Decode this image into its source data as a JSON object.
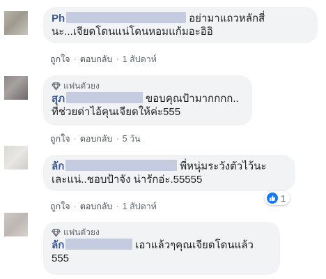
{
  "comments": [
    {
      "badge": "",
      "name": "Ph",
      "text_line1": "อย่ามาแถวหลักสี่",
      "text_line2": "นะ...เจียดโดนแน่โดนหอมแก้มอะอิอิ",
      "like": "ถูกใจ",
      "reply": "ตอบกลับ",
      "time": "1 สัปดาห์"
    },
    {
      "badge": "แฟนตัวยง",
      "name": "สุภ",
      "text_line1": "ขอบคุณป้ามากกกก..",
      "text_line2": "ที่ช่วยด่าไอ้คุนเจียดให้ค่ะ555",
      "like": "ถูกใจ",
      "reply": "ตอบกลับ",
      "time": "5 วัน"
    },
    {
      "badge": "",
      "name": "ลัก",
      "text_line1": "พี่หนุ่มระวังตัวไว้นะ",
      "text_line2": "เละแน่..ชอบป้าจัง น่ารักอ่ะ.55555",
      "like": "ถูกใจ",
      "reply": "ตอบกลับ",
      "time": "1 สัปดาห์",
      "reaction_count": "1"
    },
    {
      "badge": "แฟนตัวยง",
      "name": "ลัก",
      "text_line1": "เอาแล้วๆคุณเจียดโดนแล้ว",
      "text_line2": "555"
    }
  ],
  "colors": {
    "name": "#385898",
    "bubble": "#f2f3f5",
    "meta": "#606770",
    "like_blue": "#1877f2"
  },
  "icons": [
    "diamond-fan-badge-icon",
    "like-reaction-icon"
  ]
}
